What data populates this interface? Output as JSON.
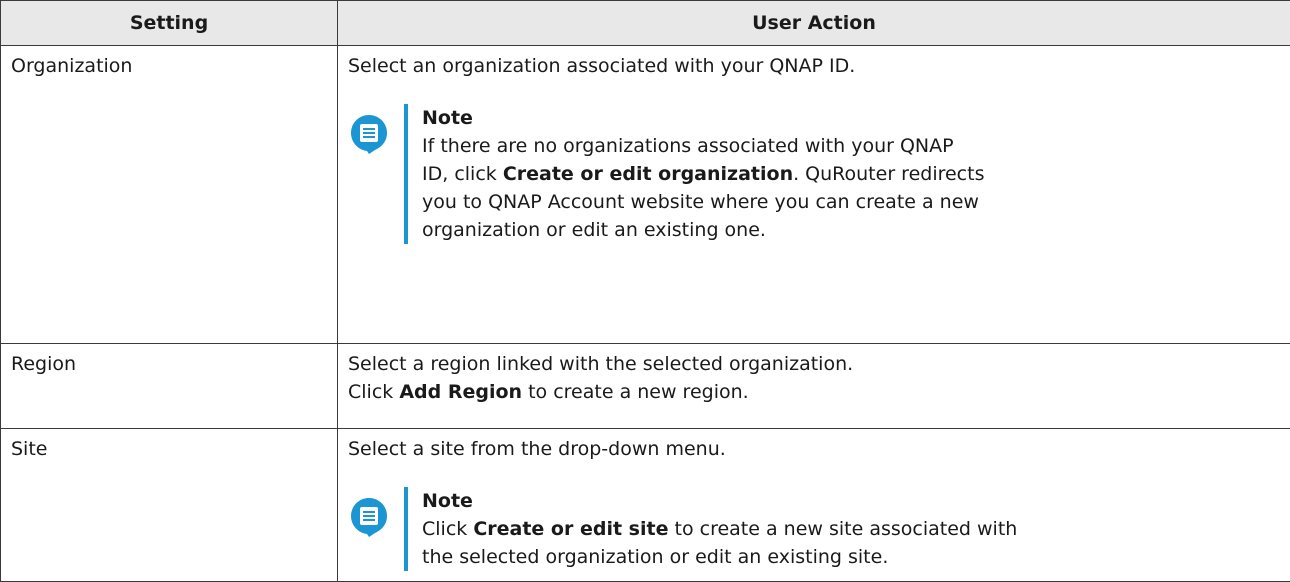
{
  "table": {
    "headers": [
      "Setting",
      "User Action"
    ],
    "rows": [
      {
        "setting": "Organization",
        "action": "Select an organization associated with your QNAP ID.",
        "note": {
          "title": "Note",
          "line1": "If there are no organizations associated with your QNAP",
          "line2_pre": "ID, click ",
          "line2_bold": "Create or edit organization",
          "line2_post": ". QuRouter redirects",
          "line3": "you to QNAP Account website where you can create a new",
          "line4": "organization or edit an existing one."
        }
      },
      {
        "setting": "Region",
        "action_line1": "Select a region linked with the selected organization.",
        "action_line2_pre": "Click ",
        "action_line2_bold": "Add Region",
        "action_line2_post": " to create a new region."
      },
      {
        "setting": "Site",
        "action": "Select a site from the drop-down menu.",
        "note": {
          "title": "Note",
          "line1_pre": "Click ",
          "line1_bold": "Create or edit site",
          "line1_post": " to create a new site associated with",
          "line2": "the selected organization or edit an existing site."
        }
      }
    ]
  },
  "colors": {
    "note_accent": "#1b96d3",
    "header_bg": "#e8e8e8"
  },
  "icons": {
    "note": "note-speech-bubble-icon"
  }
}
